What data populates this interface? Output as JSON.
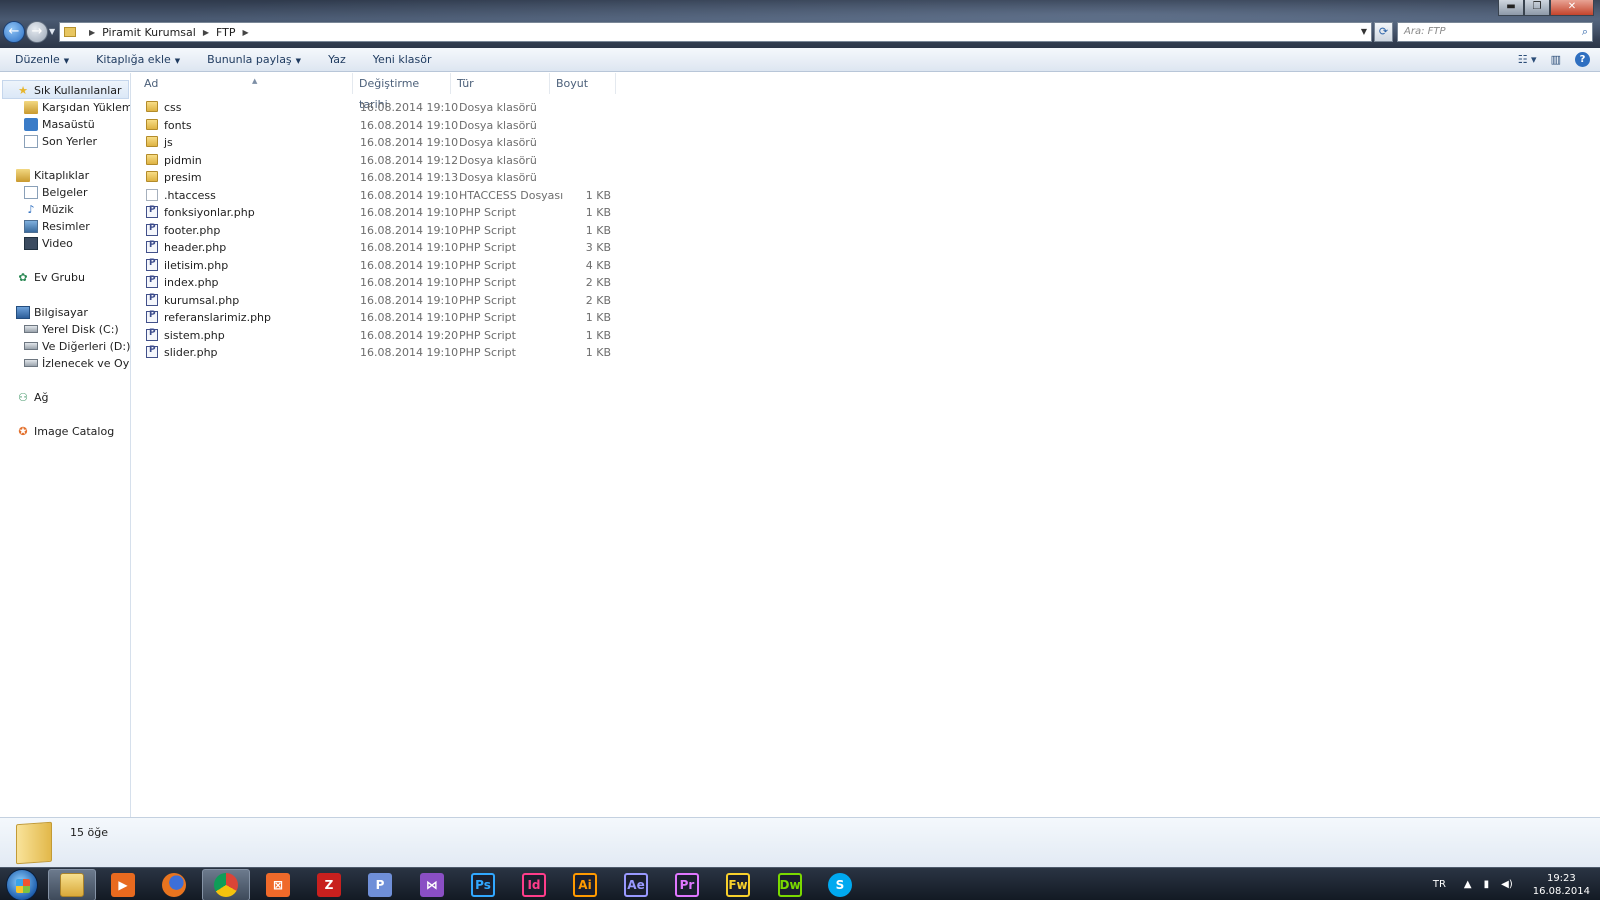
{
  "window": {
    "controls": {
      "minimize": "▬",
      "maximize": "❐",
      "close": "✕"
    }
  },
  "address": {
    "crumbs": [
      "Piramit Kurumsal",
      "FTP"
    ],
    "search_placeholder": "Ara: FTP"
  },
  "toolbar": {
    "organize": "Düzenle",
    "add_to_library": "Kitaplığa ekle",
    "share_with": "Bununla paylaş",
    "burn": "Yaz",
    "new_folder": "Yeni klasör"
  },
  "sidebar": {
    "favorites": "Sık Kullanılanlar",
    "downloads": "Karşıdan Yüklemeler",
    "desktop": "Masaüstü",
    "recent": "Son Yerler",
    "libraries": "Kitaplıklar",
    "documents": "Belgeler",
    "music": "Müzik",
    "pictures": "Resimler",
    "videos": "Video",
    "homegroup": "Ev Grubu",
    "computer": "Bilgisayar",
    "disk_c": "Yerel Disk (C:)",
    "disk_d": "Ve Diğerleri (D:)",
    "disk_e": "İzlenecek ve Oynanacaklar",
    "network": "Ağ",
    "image_catalog": "Image Catalog"
  },
  "columns": {
    "name": "Ad",
    "date": "Değiştirme tarihi",
    "type": "Tür",
    "size": "Boyut"
  },
  "files": [
    {
      "name": "css",
      "date": "16.08.2014 19:10",
      "type": "Dosya klasörü",
      "size": "",
      "kind": "folder"
    },
    {
      "name": "fonts",
      "date": "16.08.2014 19:10",
      "type": "Dosya klasörü",
      "size": "",
      "kind": "folder"
    },
    {
      "name": "js",
      "date": "16.08.2014 19:10",
      "type": "Dosya klasörü",
      "size": "",
      "kind": "folder"
    },
    {
      "name": "pidmin",
      "date": "16.08.2014 19:12",
      "type": "Dosya klasörü",
      "size": "",
      "kind": "folder"
    },
    {
      "name": "presim",
      "date": "16.08.2014 19:13",
      "type": "Dosya klasörü",
      "size": "",
      "kind": "folder"
    },
    {
      "name": ".htaccess",
      "date": "16.08.2014 19:10",
      "type": "HTACCESS Dosyası",
      "size": "1 KB",
      "kind": "file"
    },
    {
      "name": "fonksiyonlar.php",
      "date": "16.08.2014 19:10",
      "type": "PHP Script",
      "size": "1 KB",
      "kind": "php"
    },
    {
      "name": "footer.php",
      "date": "16.08.2014 19:10",
      "type": "PHP Script",
      "size": "1 KB",
      "kind": "php"
    },
    {
      "name": "header.php",
      "date": "16.08.2014 19:10",
      "type": "PHP Script",
      "size": "3 KB",
      "kind": "php"
    },
    {
      "name": "iletisim.php",
      "date": "16.08.2014 19:10",
      "type": "PHP Script",
      "size": "4 KB",
      "kind": "php"
    },
    {
      "name": "index.php",
      "date": "16.08.2014 19:10",
      "type": "PHP Script",
      "size": "2 KB",
      "kind": "php"
    },
    {
      "name": "kurumsal.php",
      "date": "16.08.2014 19:10",
      "type": "PHP Script",
      "size": "2 KB",
      "kind": "php"
    },
    {
      "name": "referanslarimiz.php",
      "date": "16.08.2014 19:10",
      "type": "PHP Script",
      "size": "1 KB",
      "kind": "php"
    },
    {
      "name": "sistem.php",
      "date": "16.08.2014 19:20",
      "type": "PHP Script",
      "size": "1 KB",
      "kind": "php"
    },
    {
      "name": "slider.php",
      "date": "16.08.2014 19:10",
      "type": "PHP Script",
      "size": "1 KB",
      "kind": "php"
    }
  ],
  "status": {
    "item_count": "15 öğe"
  },
  "taskbar": {
    "apps": [
      {
        "label": "",
        "icon": "explorer-icon",
        "color": "#e8c660"
      },
      {
        "label": "▶",
        "icon": "media-player-icon",
        "color": "#e86a1f"
      },
      {
        "label": "",
        "icon": "firefox-icon",
        "color": "#e8741f"
      },
      {
        "label": "",
        "icon": "chrome-icon",
        "color": "#3aa04a"
      },
      {
        "label": "⊠",
        "icon": "xampp-icon",
        "color": "#f06a2a"
      },
      {
        "label": "Z",
        "icon": "filezilla-icon",
        "color": "#c8201e"
      },
      {
        "label": "P",
        "icon": "phpstorm-icon",
        "color": "#6f8fd8"
      },
      {
        "label": "⋈",
        "icon": "visual-studio-icon",
        "color": "#8a4fc4"
      },
      {
        "label": "Ps",
        "icon": "photoshop-icon",
        "color": "#31a8ff"
      },
      {
        "label": "Id",
        "icon": "indesign-icon",
        "color": "#ff3d8a"
      },
      {
        "label": "Ai",
        "icon": "illustrator-icon",
        "color": "#ff9a00"
      },
      {
        "label": "Ae",
        "icon": "after-effects-icon",
        "color": "#9999ff"
      },
      {
        "label": "Pr",
        "icon": "premiere-icon",
        "color": "#e077ff"
      },
      {
        "label": "Fw",
        "icon": "fireworks-icon",
        "color": "#f7d02c"
      },
      {
        "label": "Dw",
        "icon": "dreamweaver-icon",
        "color": "#7ad900"
      },
      {
        "label": "S",
        "icon": "skype-icon",
        "color": "#00a9f0"
      }
    ],
    "lang": "TR",
    "time": "19:23",
    "date": "16.08.2014"
  }
}
